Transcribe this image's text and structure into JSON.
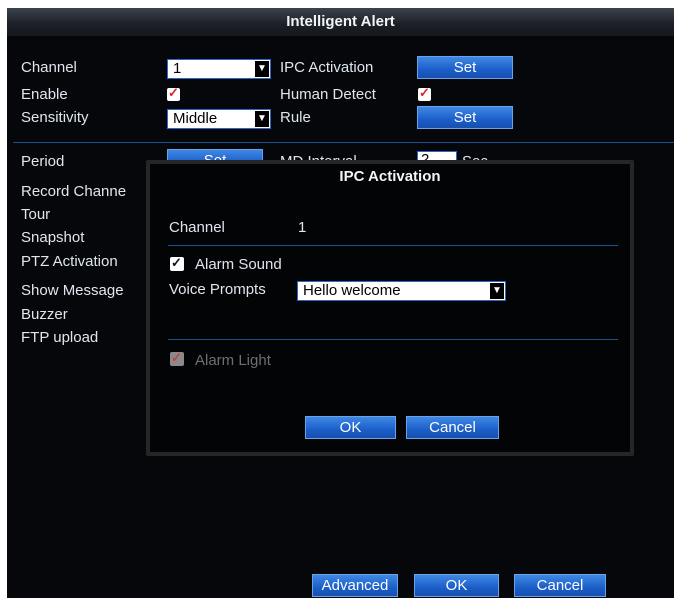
{
  "window": {
    "title": "Intelligent Alert"
  },
  "form": {
    "channel_label": "Channel",
    "channel_value": "1",
    "enable_label": "Enable",
    "enable_checked": true,
    "sensitivity_label": "Sensitivity",
    "sensitivity_value": "Middle",
    "ipc_activation_label": "IPC Activation",
    "ipc_activation_button": "Set",
    "human_detect_label": "Human Detect",
    "human_detect_checked": true,
    "rule_label": "Rule",
    "rule_button": "Set",
    "period_label": "Period",
    "period_button": "Set",
    "md_interval_label": "MD Interval",
    "md_interval_value": "2",
    "md_interval_unit": "Sec",
    "record_channel_label": "Record Channe",
    "tour_label": "Tour",
    "snapshot_label": "Snapshot",
    "ptz_activation_label": "PTZ Activation",
    "show_message_label": "Show Message",
    "buzzer_label": "Buzzer",
    "ftp_upload_label": "FTP upload"
  },
  "footer": {
    "advanced": "Advanced",
    "ok": "OK",
    "cancel": "Cancel"
  },
  "dialog": {
    "title": "IPC Activation",
    "channel_label": "Channel",
    "channel_value": "1",
    "alarm_sound_label": "Alarm Sound",
    "alarm_sound_checked": true,
    "voice_prompts_label": "Voice Prompts",
    "voice_prompts_value": "Hello welcome",
    "alarm_light_label": "Alarm Light",
    "alarm_light_checked": true,
    "alarm_light_disabled": true,
    "ok": "OK",
    "cancel": "Cancel"
  },
  "colors": {
    "accent": "#1f63cc",
    "background": "#05070b",
    "check_mark": "#d6282c"
  }
}
